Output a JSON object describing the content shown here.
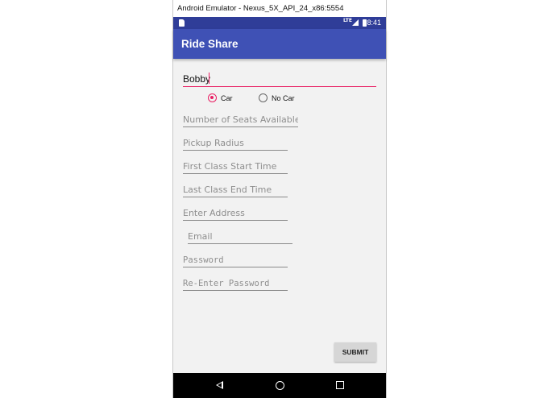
{
  "window": {
    "title": "Android Emulator - Nexus_5X_API_24_x86:5554"
  },
  "status_bar": {
    "network": "LTE",
    "time": "8:41"
  },
  "app_bar": {
    "title": "Ride Share"
  },
  "form": {
    "name_value": "Bobby",
    "radios": [
      {
        "label": "Car",
        "selected": true
      },
      {
        "label": "No Car",
        "selected": false
      }
    ],
    "seats_placeholder": "Number of Seats Available",
    "radius_placeholder": "Pickup Radius",
    "first_class_placeholder": "First Class Start Time",
    "last_class_placeholder": "Last Class End Time",
    "address_placeholder": "Enter Address",
    "email_placeholder": "Email",
    "password_placeholder": "Password",
    "reenter_password_placeholder": "Re-Enter Password",
    "submit_label": "SUBMIT"
  },
  "colors": {
    "primary": "#3f51b5",
    "primary_dark": "#2f3d98",
    "accent": "#e91e63"
  },
  "icons": [
    "sd-card-icon",
    "signal-icon",
    "battery-icon",
    "back-icon",
    "home-icon",
    "recents-icon"
  ]
}
